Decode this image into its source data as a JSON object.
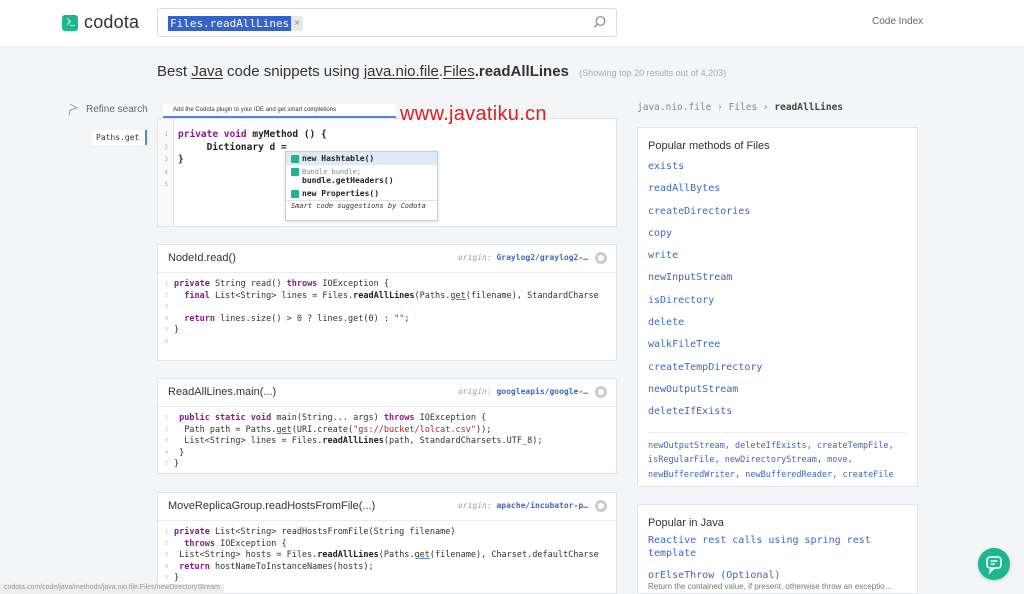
{
  "header": {
    "logo_text": "codota",
    "search_chip": "Files.readAllLines",
    "search_chip_close": "×",
    "code_index": "Code Index"
  },
  "title": {
    "prefix": "Best",
    "language": "Java",
    "middle": "code snippets using",
    "package": "java.nio.file",
    "class": "Files",
    "method": ".readAllLines",
    "count": "(Showing top 20 results out of 4,203)"
  },
  "refine": {
    "label": "Refine search",
    "chip": "Paths.get"
  },
  "promo": {
    "tab": "Add the Codota plugin to your IDE and get smart completions",
    "line_numbers": [
      "1",
      "2",
      "3",
      "4",
      "5"
    ],
    "code": {
      "line1_kw": "private void",
      "line1_rest": " myMethod () {",
      "line2": "     Dictionary d = ",
      "line3": "}"
    },
    "popup": {
      "item1": "new Hashtable()",
      "item2_sub": "Bundle bundle;",
      "item2": "bundle.getHeaders()",
      "item3": "new Properties()",
      "footer": "Smart code suggestions by Codota"
    }
  },
  "watermark": "www.javatiku.cn",
  "cards": [
    {
      "title": "NodeId.read()",
      "origin_label": "origin:",
      "origin": "Graylog2/graylog2-…"
    },
    {
      "title": "ReadAllLines.main(...)",
      "origin_label": "origin:",
      "origin": "googleapis/google-…"
    },
    {
      "title": "MoveReplicaGroup.readHostsFromFile(...)",
      "origin_label": "origin:",
      "origin": "apache/incubator-p…"
    }
  ],
  "code": {
    "c1": {
      "l1a": "private",
      "l1b": " String read() ",
      "l1c": "throws",
      "l1d": " IOException {",
      "l2a": "  final",
      "l2b": " List<String> lines = Files.",
      "l2c": "readAllLines",
      "l2d": "(Paths.",
      "l2e": "get",
      "l2f": "(filename), StandardCharse",
      "l4a": "  return",
      "l4b": " lines.size() > 0 ? lines.get(0) : ",
      "l4c": "\"\"",
      "l4d": ";",
      "l5": "}"
    },
    "c2": {
      "l1a": " public static void",
      "l1b": " main(String... args) ",
      "l1c": "throws",
      "l1d": " IOException {",
      "l2a": "  Path path = Paths.",
      "l2b": "get",
      "l2c": "(URI.create(",
      "l2d": "\"gs://bucket/lolcat.csv\"",
      "l2e": "));",
      "l3a": "  List<String> lines = Files.",
      "l3b": "readAllLines",
      "l3c": "(path, StandardCharsets.UTF_8);",
      "l4": " }",
      "l5": "}"
    },
    "c3": {
      "l1a": "private",
      "l1b": " List<String> readHostsFromFile(String filename)",
      "l2a": "  throws",
      "l2b": " IOException {",
      "l3a": " List<String> hosts = Files.",
      "l3b": "readAllLines",
      "l3c": "(Paths.",
      "l3d": "get",
      "l3e": "(filename), Charset.defaultCharse",
      "l4a": " return",
      "l4b": " hostNameToInstanceNames(hosts);",
      "l5": "}"
    }
  },
  "sidebar": {
    "crumb_package": "java.nio.file",
    "crumb_class": "Files",
    "crumb_method": "readAllLines",
    "crumb_sep": "›",
    "methods_title": "Popular methods of Files",
    "methods": [
      "exists",
      "readAllBytes",
      "createDirectories",
      "copy",
      "write",
      "newInputStream",
      "isDirectory",
      "delete",
      "walkFileTree",
      "createTempDirectory",
      "newOutputStream",
      "deleteIfExists"
    ],
    "more_methods": [
      "newOutputStream,",
      "deleteIfExists,",
      "createTempFile,",
      "isRegularFile,",
      "newDirectoryStream,",
      "move,",
      "newBufferedWriter,",
      "newBufferedReader,",
      "createFile"
    ],
    "java_title": "Popular in Java",
    "java_items": [
      "Reactive rest calls using spring rest template",
      "orElseThrow (Optional)"
    ],
    "java_desc": "Return the contained value, if present, otherwise throw an exceptio…"
  },
  "status_url": "codota.com/code/java/methods/java.nio.file.Files/newDirectoryStream",
  "colors": {
    "brand": "#1fb58f",
    "link": "#3a67c6",
    "keyword": "#8b1a8b",
    "watermark": "#e02020"
  },
  "icons": {
    "logo": "terminal-prompt-icon",
    "search": "magnifier-icon",
    "refine": "funnel-icon",
    "origin": "github-icon",
    "chat": "chat-bubble-icon"
  }
}
